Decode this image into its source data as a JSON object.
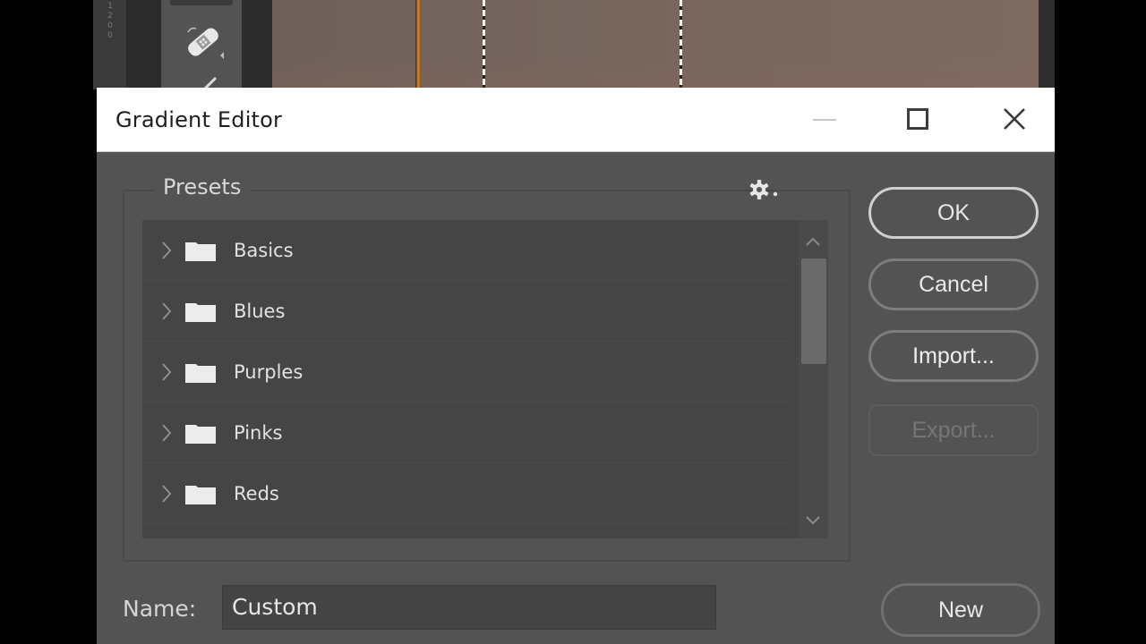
{
  "background_app": {
    "ruler_text": "1200",
    "tools": [
      "healing-brush-tool",
      "brush-tool"
    ],
    "colors": {
      "canvas": "#76665e",
      "guide_orange": "#d58a2a"
    }
  },
  "dialog": {
    "title": "Gradient Editor",
    "window_controls": {
      "minimize": "minimize",
      "maximize": "maximize",
      "close": "close"
    },
    "presets": {
      "label": "Presets",
      "settings_icon": "gear-icon",
      "folders": [
        {
          "label": "Basics",
          "icon": "folder-icon",
          "expanded": false
        },
        {
          "label": "Blues",
          "icon": "folder-icon",
          "expanded": false
        },
        {
          "label": "Purples",
          "icon": "folder-icon",
          "expanded": false
        },
        {
          "label": "Pinks",
          "icon": "folder-icon",
          "expanded": false
        },
        {
          "label": "Reds",
          "icon": "folder-icon",
          "expanded": false
        }
      ]
    },
    "buttons": {
      "ok": "OK",
      "cancel": "Cancel",
      "import": "Import...",
      "export": "Export...",
      "new": "New"
    },
    "name_field": {
      "label": "Name:",
      "value": "Custom"
    }
  }
}
